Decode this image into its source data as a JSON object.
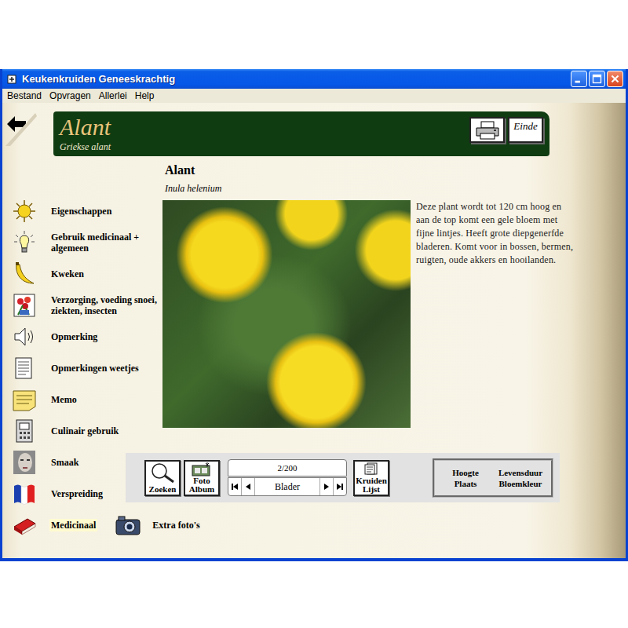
{
  "window": {
    "title": "Keukenkruiden Geneeskrachtig"
  },
  "menu": [
    "Bestand",
    "Opvragen",
    "Allerlei",
    "Help"
  ],
  "header": {
    "title": "Alant",
    "subtitle": "Griekse alant",
    "end_button": "Einde"
  },
  "sidebar": {
    "items": [
      {
        "label": "Eigenschappen",
        "selected": false
      },
      {
        "label": "Gebruik medicinaal + algemeen",
        "selected": false
      },
      {
        "label": "Kweken",
        "selected": false
      },
      {
        "label": "Verzorging, voeding snoei, ziekten, insecten",
        "selected": false
      },
      {
        "label": "Opmerking",
        "selected": false
      },
      {
        "label": "Opmerkingen weetjes",
        "selected": false
      },
      {
        "label": "Memo",
        "selected": false
      },
      {
        "label": "Culinair gebruik",
        "selected": false
      },
      {
        "label": "Smaak",
        "selected": false
      },
      {
        "label": "Verspreiding",
        "selected": false
      },
      {
        "label": "Medicinaal",
        "selected": true
      }
    ],
    "extra": "Extra foto's"
  },
  "plant": {
    "name": "Alant",
    "latin": "Inula helenium",
    "description": "Deze plant wordt tot 120 cm hoog en aan de top komt een gele bloem met fijne lintjes. Heeft grote diepgenerfde bladeren. Komt voor in bossen, bermen, ruigten, oude akkers en hooilanden."
  },
  "toolbar": {
    "search": "Zoeken",
    "album": "Foto Album",
    "counter": "2/200",
    "browse": "Blader",
    "list": "Kruiden Lijst",
    "filters": [
      "Hoogte",
      "Levensduur",
      "Plaats",
      "Bloemkleur"
    ]
  }
}
